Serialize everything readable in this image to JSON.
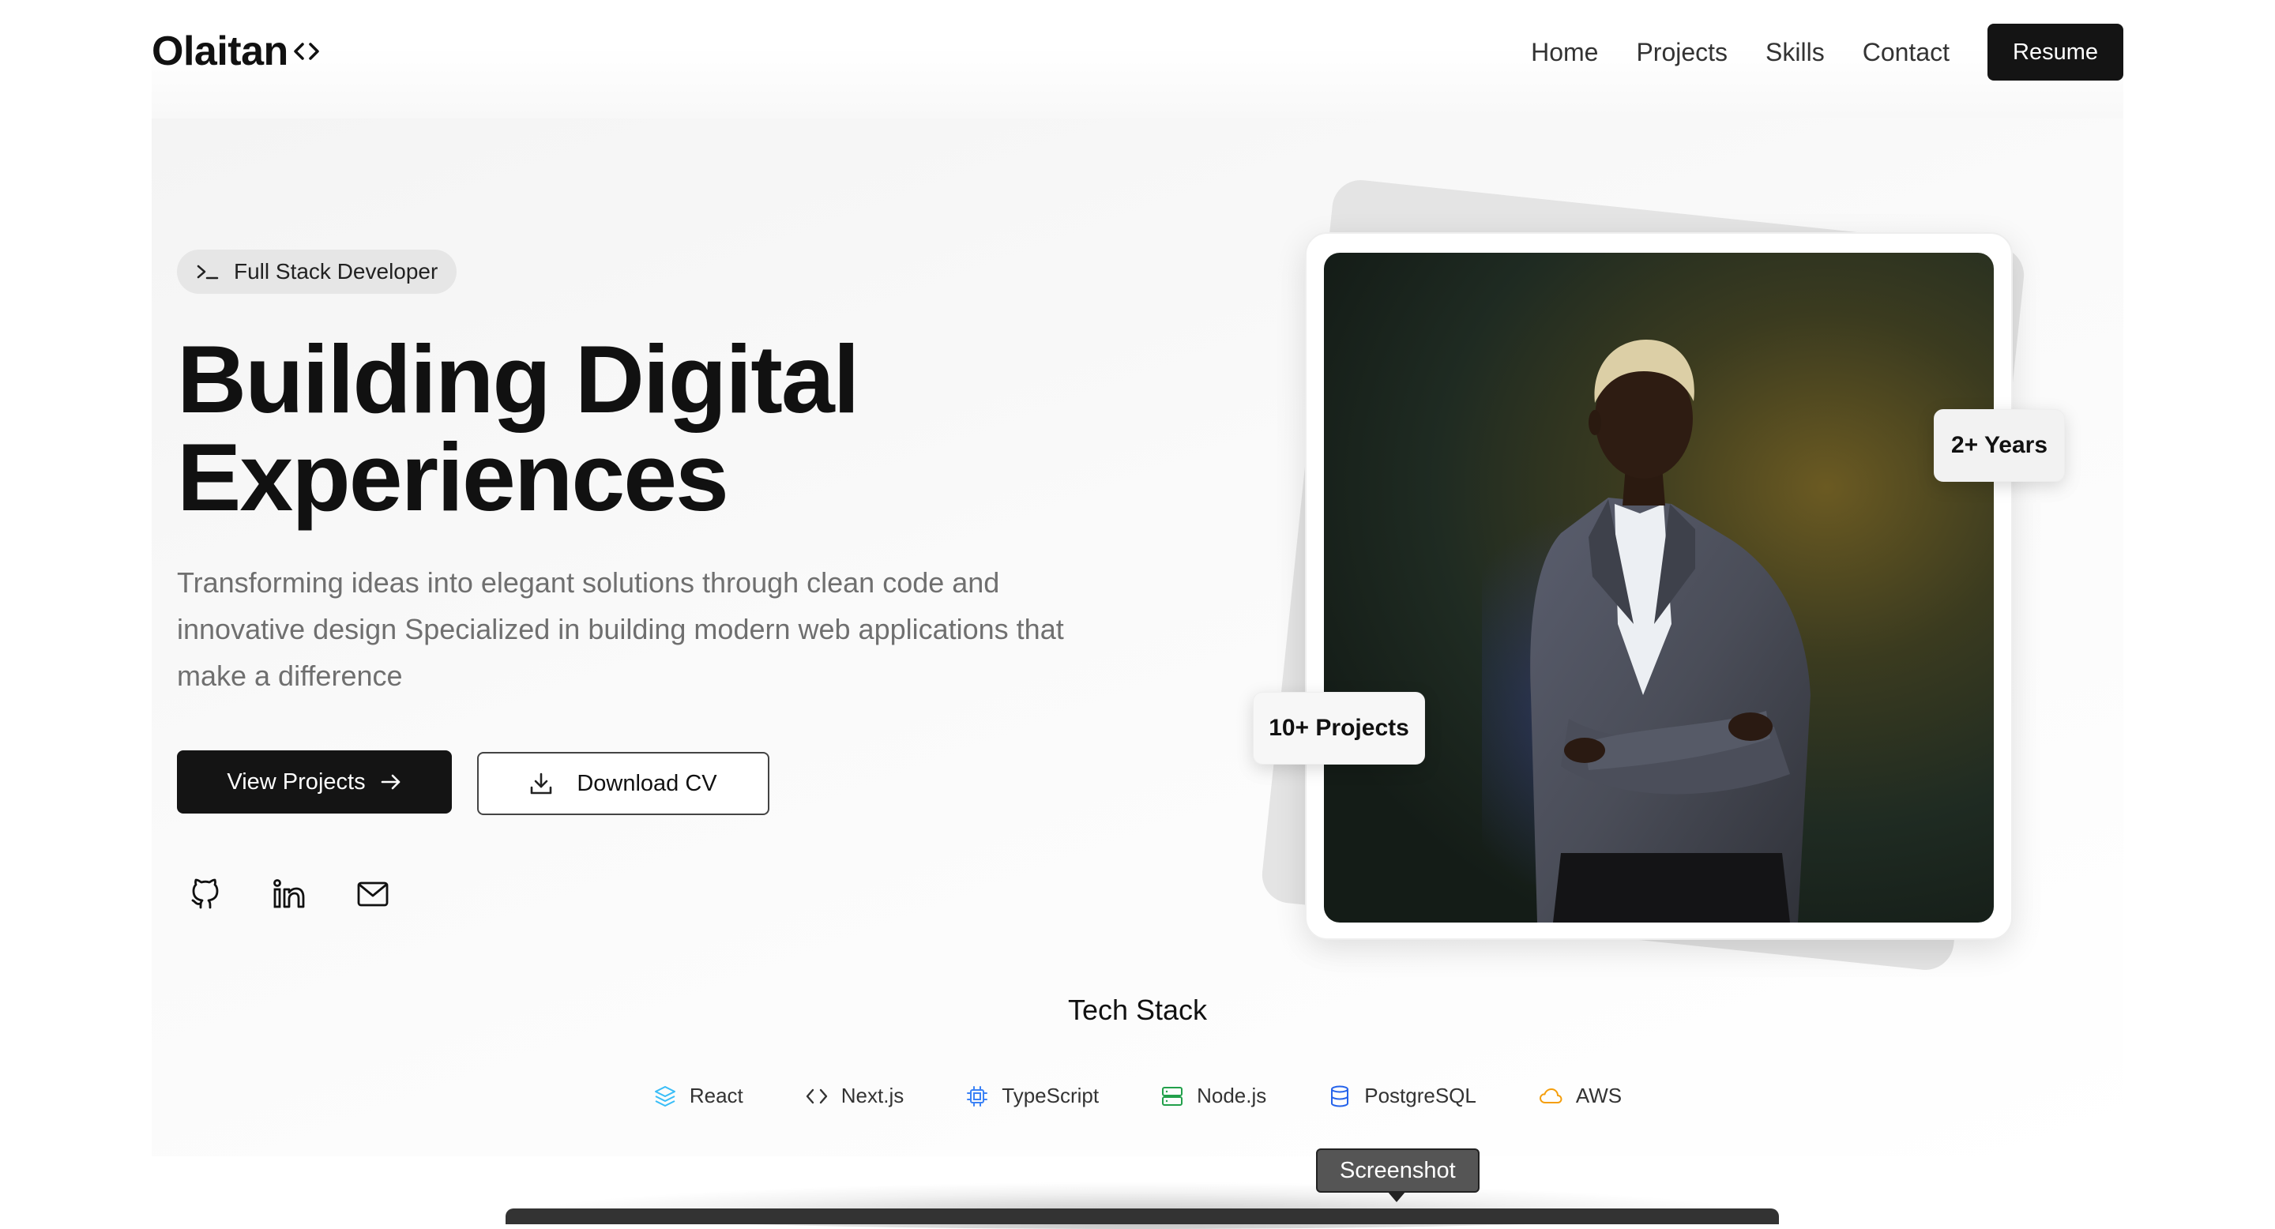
{
  "nav": {
    "logo": "Olaitan",
    "links": [
      "Home",
      "Projects",
      "Skills",
      "Contact"
    ],
    "resume_label": "Resume"
  },
  "hero": {
    "badge": "Full Stack Developer",
    "headline_line1": "Building Digital",
    "headline_line2": "Experiences",
    "subtitle": "Transforming ideas into elegant solutions through clean code and innovative design Specialized in building modern web applications that make a difference",
    "primary_button": "View Projects",
    "secondary_button": "Download CV",
    "socials": [
      "github-icon",
      "linkedin-icon",
      "mail-icon"
    ]
  },
  "stats": {
    "years": "2+ Years",
    "projects": "10+ Projects"
  },
  "tech_stack": {
    "title": "Tech Stack",
    "items": [
      {
        "label": "React",
        "icon": "layers-icon",
        "color": "#38bdf8"
      },
      {
        "label": "Next.js",
        "icon": "code-icon",
        "color": "#333333"
      },
      {
        "label": "TypeScript",
        "icon": "cpu-icon",
        "color": "#3b82f6"
      },
      {
        "label": "Node.js",
        "icon": "server-icon",
        "color": "#22a04b"
      },
      {
        "label": "PostgreSQL",
        "icon": "database-icon",
        "color": "#2563eb"
      },
      {
        "label": "AWS",
        "icon": "cloud-icon",
        "color": "#f59e0b"
      }
    ]
  },
  "tooltip": "Screenshot"
}
